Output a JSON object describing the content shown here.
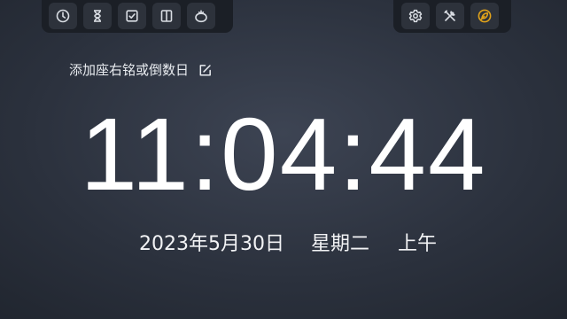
{
  "toolbar_left": {
    "buttons": [
      {
        "icon": "clock-icon",
        "tooltip": ""
      },
      {
        "icon": "hourglass-icon",
        "tooltip": ""
      },
      {
        "icon": "checkbox-icon",
        "tooltip": ""
      },
      {
        "icon": "book-icon",
        "tooltip": ""
      },
      {
        "icon": "tomato-icon",
        "tooltip": ""
      }
    ]
  },
  "toolbar_right": {
    "buttons": [
      {
        "icon": "gear-icon"
      },
      {
        "icon": "tools-icon"
      },
      {
        "icon": "leaf-icon"
      }
    ]
  },
  "motto": {
    "text": "添加座右铭或倒数日"
  },
  "clock": {
    "time": "11:04:44"
  },
  "date": {
    "date_text": "2023年5月30日",
    "weekday": "星期二",
    "ampm": "上午"
  },
  "colors": {
    "background": "#2b313d",
    "toolbar": "#1b1f26",
    "button": "#2d323b",
    "icon": "#d9dde3",
    "accent": "#e0a21a"
  }
}
